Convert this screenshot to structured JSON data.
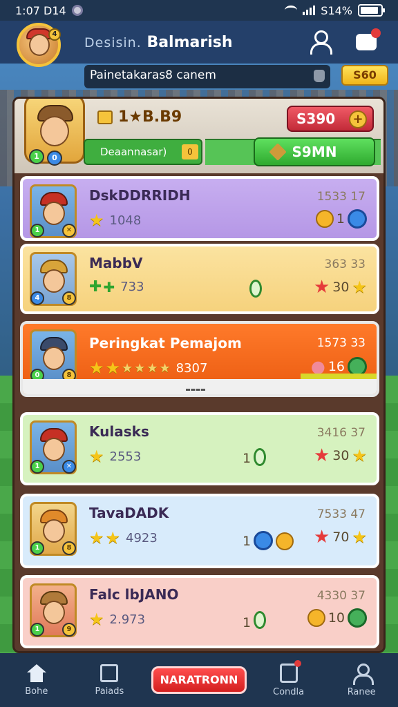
{
  "status_bar": {
    "time": "1:07 D14",
    "battery": "S14%",
    "battery_level": 0.9
  },
  "header": {
    "title_prefix": "Desisin.",
    "title": "Balmarish"
  },
  "search": {
    "text": "Painetakaras8 canem"
  },
  "gold_button": {
    "label": "S60"
  },
  "profile": {
    "coins": "1★B.B9",
    "score": "S390",
    "score_plus": "+",
    "progress_label": "Deaannasar)",
    "progress_tag": "0",
    "action_label": "S9MN",
    "badge_left": "1",
    "badge_right": "0"
  },
  "rows": [
    {
      "name": "DskDDRRIDH",
      "points": "1533 17",
      "stat": "1048",
      "right_value": "1",
      "b1": "1",
      "b2": "✕"
    },
    {
      "name": "MabbV",
      "points": "363 33",
      "stat": "733",
      "right_value": "30",
      "b1": "4",
      "b2": "8"
    },
    {
      "name": "Peringkat Pemajom",
      "points": "1573 33",
      "stat": "8307",
      "right_value": "16",
      "b1": "0",
      "b2": "8"
    },
    {
      "name": "Kulasks",
      "points": "3416 37",
      "stat": "2553",
      "mid_value": "1",
      "right_value": "30",
      "b1": "1",
      "b2": "✕"
    },
    {
      "name": "TavaDADK",
      "points": "7533 47",
      "stat": "4923",
      "mid_value": "1",
      "right_value": "70",
      "b1": "1",
      "b2": "8"
    },
    {
      "name": "Falc lbJANO",
      "points": "4330 37",
      "stat": "2.973",
      "mid_value": "1",
      "right_value": "10",
      "b1": "1",
      "b2": "9"
    }
  ],
  "nav": {
    "items": [
      {
        "label": "Bohe"
      },
      {
        "label": "Paiads"
      },
      {
        "label": "Condla"
      },
      {
        "label": "Ranee"
      }
    ],
    "cta": "NARATRONN"
  },
  "colors": {
    "header_bg": "#24406a",
    "status_bg": "#1f3550",
    "cta_red": "#d31f1f",
    "highlight_orange": "#ea5a10"
  }
}
